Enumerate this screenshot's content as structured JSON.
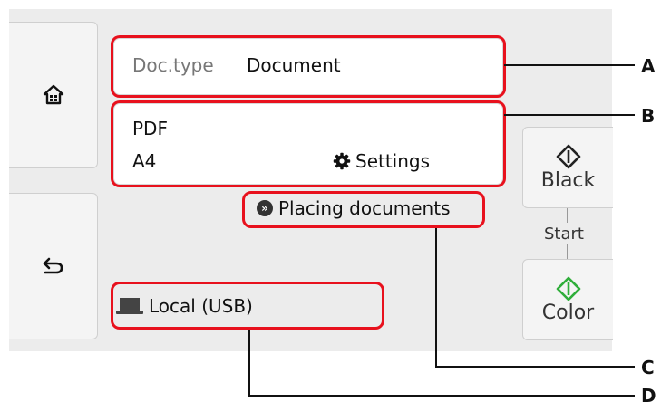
{
  "doc_type": {
    "label": "Doc.type",
    "value": "Document"
  },
  "file_settings": {
    "format": "PDF",
    "size": "A4",
    "settings_label": "Settings"
  },
  "placing_documents": {
    "label": "Placing documents"
  },
  "save_location": {
    "label": "Local (USB)"
  },
  "start": {
    "black_label": "Black",
    "color_label": "Color",
    "start_label": "Start"
  },
  "callouts": {
    "a": "A",
    "b": "B",
    "c": "C",
    "d": "D"
  },
  "colors": {
    "callout_border": "#e8111d",
    "color_start_green": "#2fae3a"
  }
}
